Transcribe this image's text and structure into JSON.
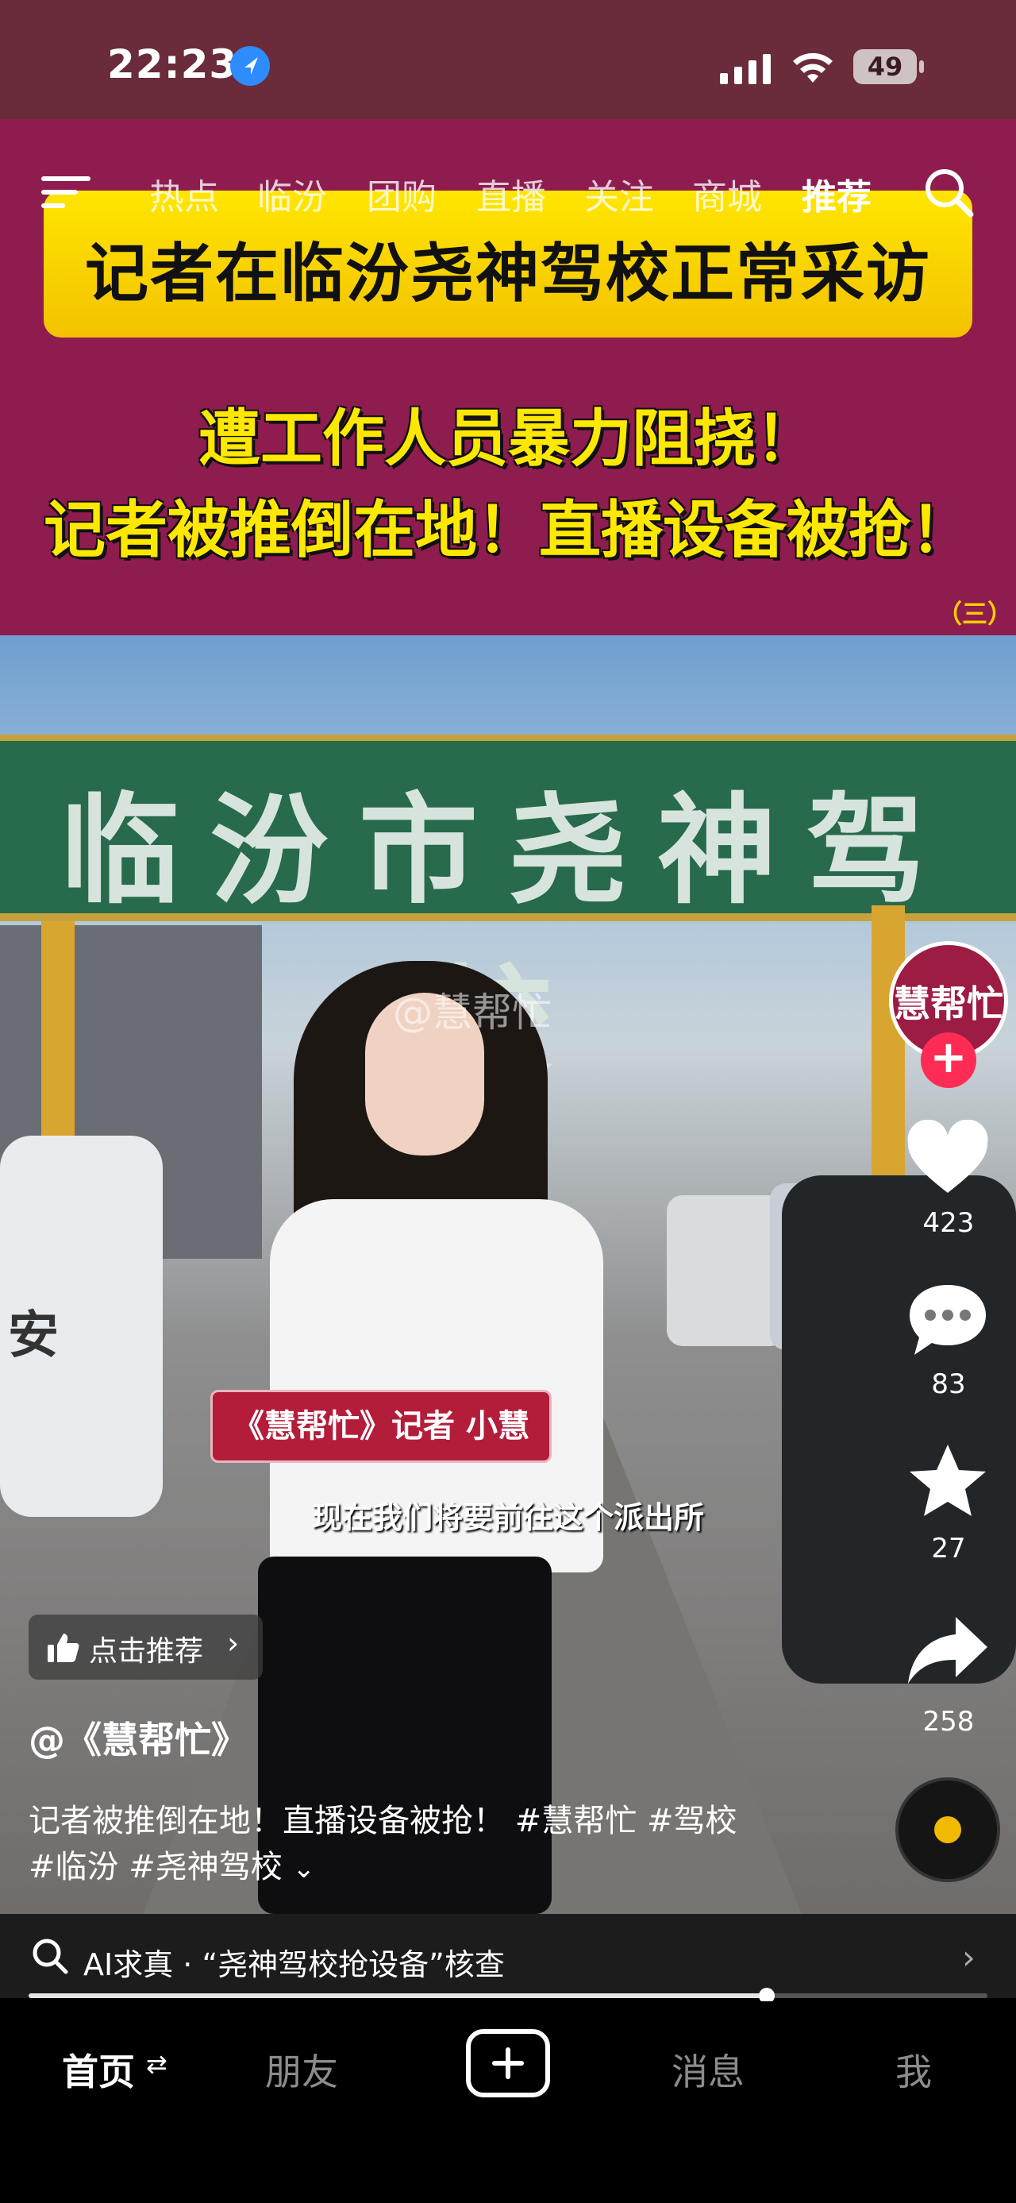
{
  "status_bar": {
    "time": "22:23",
    "battery": "49"
  },
  "top_nav": {
    "tabs": [
      {
        "label": "热点",
        "active": false
      },
      {
        "label": "临汾",
        "active": false
      },
      {
        "label": "团购",
        "active": false
      },
      {
        "label": "直播",
        "active": false
      },
      {
        "label": "关注",
        "active": false
      },
      {
        "label": "商城",
        "active": false
      },
      {
        "label": "推荐",
        "active": true
      }
    ]
  },
  "video": {
    "banner_headline": "记者在临汾尧神驾校正常采访",
    "banner_line1": "遭工作人员暴力阻挠！",
    "banner_line2": "记者被推倒在地！直播设备被抢！",
    "banner_episode": "（三）",
    "arch_sign": "临汾市尧神驾校",
    "car_text": "安",
    "watermark": "@慧帮忙",
    "name_tag": "《慧帮忙》记者 小慧",
    "subtitle": "现在我们将要前往这个派出所"
  },
  "right_rail": {
    "avatar_text": "慧帮忙",
    "follow_symbol": "+",
    "likes": "423",
    "comments": "83",
    "favorites": "27",
    "shares": "258"
  },
  "post": {
    "recommend_label": "点击推荐",
    "recommend_chevron": "›",
    "author": "@《慧帮忙》",
    "caption_line1": "记者被推倒在地！直播设备被抢！ #慧帮忙 #驾校",
    "caption_line2": "#临汾 #尧神驾校",
    "expand_chevron": "⌄"
  },
  "ai_search": {
    "text": "AI求真 · “尧神驾校抢设备”核查",
    "chevron": "›"
  },
  "playback": {
    "progress": 0.77
  },
  "bottom_tabs": {
    "home": "首页",
    "home_swap": "⇄",
    "friends": "朋友",
    "messages": "消息",
    "me": "我"
  },
  "colors": {
    "banner_bg": "#8f1c4f",
    "banner_yellow": "#ffe600",
    "follow_red": "#fe2c55",
    "arch_green": "#276a4c"
  },
  "icons": [
    "location-arrow-icon",
    "signal-icon",
    "wifi-icon",
    "battery-icon",
    "menu-icon",
    "search-icon",
    "heart-icon",
    "comment-icon",
    "star-icon",
    "share-icon",
    "music-disc-icon",
    "thumb-up-icon",
    "ai-search-icon",
    "plus-icon"
  ]
}
